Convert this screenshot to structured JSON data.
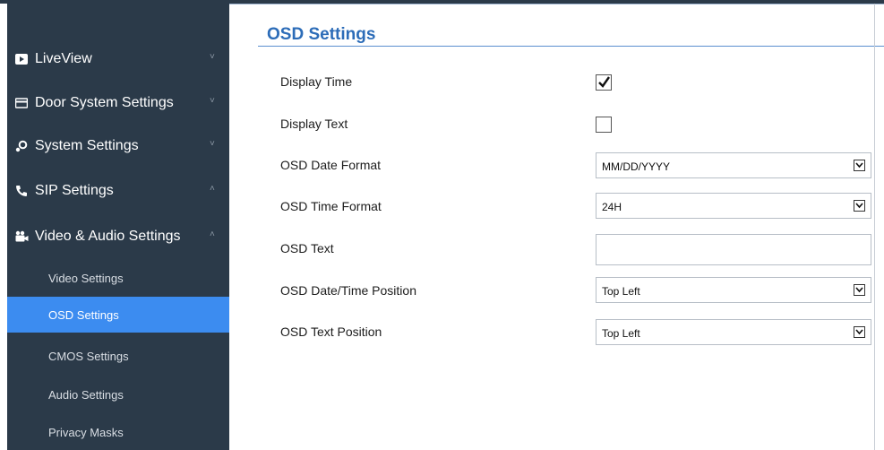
{
  "sidebar": {
    "items": [
      {
        "label": "LiveView",
        "icon": "play-icon",
        "chevron": "˅"
      },
      {
        "label": "Door System Settings",
        "icon": "card-icon",
        "chevron": "˅"
      },
      {
        "label": "System Settings",
        "icon": "gears-icon",
        "chevron": "˅"
      },
      {
        "label": "SIP Settings",
        "icon": "phone-icon",
        "chevron": "˄"
      },
      {
        "label": "Video & Audio Settings",
        "icon": "camera-icon",
        "chevron": "˄"
      }
    ],
    "subitems": [
      {
        "label": "Video Settings"
      },
      {
        "label": "OSD Settings",
        "active": true
      },
      {
        "label": "CMOS Settings"
      },
      {
        "label": "Audio Settings"
      },
      {
        "label": "Privacy Masks"
      }
    ]
  },
  "main": {
    "title": "OSD Settings",
    "fields": {
      "display_time": {
        "label": "Display Time",
        "checked": true
      },
      "display_text": {
        "label": "Display Text",
        "checked": false
      },
      "date_format": {
        "label": "OSD Date Format",
        "value": "MM/DD/YYYY"
      },
      "time_format": {
        "label": "OSD Time Format",
        "value": "24H"
      },
      "osd_text": {
        "label": "OSD Text",
        "value": ""
      },
      "datetime_position": {
        "label": "OSD Date/Time Position",
        "value": "Top Left"
      },
      "text_position": {
        "label": "OSD Text Position",
        "value": "Top Left"
      }
    }
  },
  "colors": {
    "sidebar_bg": "#2b3a49",
    "active_item": "#3c8cf0",
    "title_color": "#2c6cb8"
  }
}
